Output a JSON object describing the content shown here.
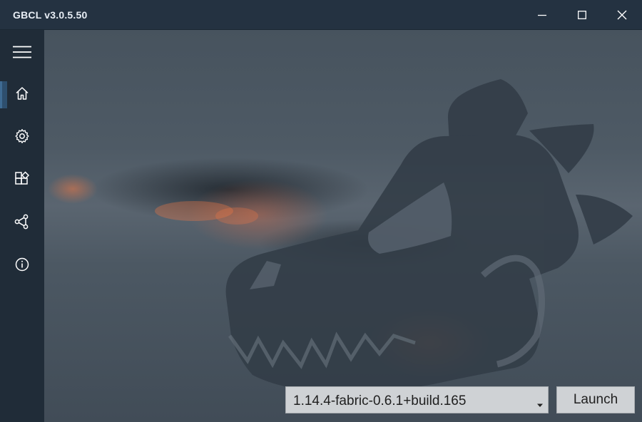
{
  "window": {
    "title": "GBCL v3.0.5.50",
    "controls": {
      "minimize_icon": "minimize-icon",
      "maximize_icon": "maximize-icon",
      "close_icon": "close-icon"
    }
  },
  "sidebar": {
    "items": [
      {
        "name": "menu",
        "icon": "hamburger-menu-icon"
      },
      {
        "name": "home",
        "icon": "home-icon",
        "active": true
      },
      {
        "name": "settings",
        "icon": "gear-icon"
      },
      {
        "name": "extensions",
        "icon": "add-ons-icon"
      },
      {
        "name": "share",
        "icon": "share-icon"
      },
      {
        "name": "about",
        "icon": "info-icon"
      }
    ]
  },
  "main": {
    "background_logo": "wolf-skull-logo",
    "version_select": {
      "selected": "1.14.4-fabric-0.6.1+build.165",
      "caret_icon": "caret-down-icon"
    },
    "launch_label": "Launch"
  },
  "colors": {
    "titlebar": "#243241",
    "sidebar": "#202c38",
    "active_indicator": "#3f6b93",
    "button_bg": "#cfd2d5"
  }
}
